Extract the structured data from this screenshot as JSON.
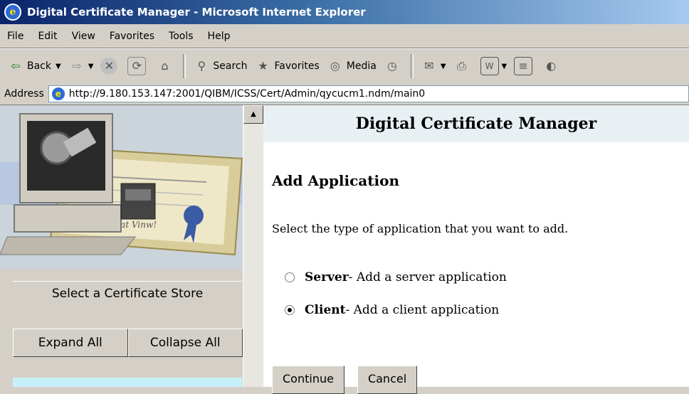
{
  "window": {
    "title": "Digital Certificate Manager - Microsoft Internet Explorer"
  },
  "menu": [
    "File",
    "Edit",
    "View",
    "Favorites",
    "Tools",
    "Help"
  ],
  "toolbar": {
    "back": "Back",
    "search": "Search",
    "favorites": "Favorites",
    "media": "Media"
  },
  "address": {
    "label": "Address",
    "url": "http://9.180.153.147:2001/QIBM/ICSS/Cert/Admin/qycucm1.ndm/main0"
  },
  "sidebar": {
    "store_label": "Select a Certificate Store",
    "expand_all": "Expand All",
    "collapse_all": "Collapse All"
  },
  "main": {
    "header": "Digital Certificate Manager",
    "heading": "Add Application",
    "intro": "Select the type of application that you want to add.",
    "options": [
      {
        "label": "Server",
        "desc": " - Add a server application",
        "selected": false
      },
      {
        "label": "Client",
        "desc": " - Add a client application",
        "selected": true
      }
    ],
    "continue": "Continue",
    "cancel": "Cancel"
  }
}
